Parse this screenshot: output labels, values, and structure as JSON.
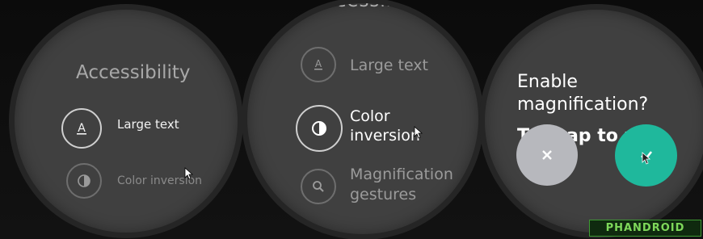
{
  "screen1": {
    "title": "Accessibility",
    "items": [
      {
        "label": "Large text",
        "icon": "large-text-icon"
      },
      {
        "label": "Color inversion",
        "icon": "color-inversion-icon"
      }
    ]
  },
  "screen2": {
    "cut_title": "ccessib",
    "items": [
      {
        "label": "Large text",
        "icon": "large-text-icon"
      },
      {
        "label": "Color inversion",
        "icon": "color-inversion-icon"
      },
      {
        "label": "Magnification gestures",
        "icon": "magnify-icon"
      }
    ]
  },
  "screen3": {
    "question": "Enable magnification?",
    "partial_text": "Tap  tap to z",
    "cancel_icon": "close-icon",
    "confirm_icon": "check-icon",
    "confirm_color": "#1fb89c",
    "cancel_color": "#b7b8bd"
  },
  "watermark": "PHANDROID"
}
